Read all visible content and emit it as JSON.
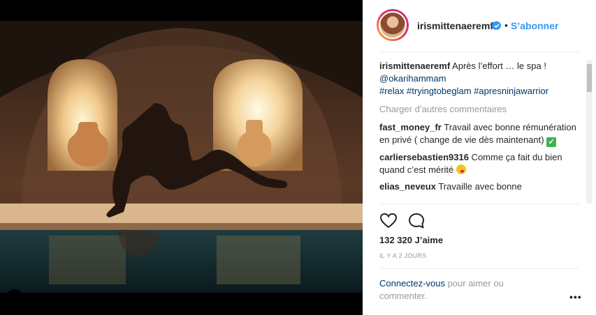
{
  "post": {
    "username": "irismittenaeremf",
    "follow_label": "S’abonner",
    "likes": "132 320 J’aime",
    "time_ago": "IL Y A 2 JOURS",
    "login_link": "Connectez-vous",
    "login_rest": " pour aimer ou commenter.",
    "more_label": "•••"
  },
  "caption": {
    "user": "irismittenaeremf",
    "text": " Après l’effort … le spa !",
    "mention": "@okarihammam",
    "hashtags": "#relax #tryingtobeglam #apresninjawarrior"
  },
  "load_more": "Charger d’autres commentaires",
  "comments": [
    {
      "user": "fast_money_fr",
      "text": " Travail avec bonne rémunération en privé ( change de vie dès maintenant) ",
      "emoji": "check-mark-emoji"
    },
    {
      "user": "carliersebastien9316",
      "text": " Comme ça fait du bien quand c’est mérité ",
      "emoji": "face-tongue-emoji"
    },
    {
      "user": "elias_neveux",
      "text": " Travaille avec bonne",
      "emoji": ""
    }
  ],
  "icons": {
    "like": "heart-outline-icon",
    "comment": "speech-bubble-icon",
    "verified": "verified-badge-icon",
    "user_tag": "user-tag-icon"
  },
  "colors": {
    "accent": "#3897f0",
    "link": "#003569",
    "muted": "#999999",
    "verified": "#3897f0"
  }
}
